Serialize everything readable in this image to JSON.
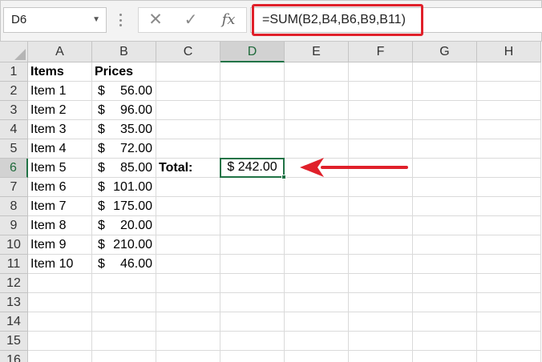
{
  "name_box": {
    "value": "D6"
  },
  "formula_bar": {
    "cancel_icon": "✕",
    "enter_icon": "✓",
    "function_icon": "fx",
    "formula": "=SUM(B2,B4,B6,B9,B11)"
  },
  "columns": [
    "A",
    "B",
    "C",
    "D",
    "E",
    "F",
    "G",
    "H"
  ],
  "rows": [
    "1",
    "2",
    "3",
    "4",
    "5",
    "6",
    "7",
    "8",
    "9",
    "10",
    "11",
    "12",
    "13",
    "14",
    "15",
    "16"
  ],
  "cells": {
    "A1": "Items",
    "B1": "Prices",
    "A2": "Item 1",
    "B2_sym": "$",
    "B2_val": "56.00",
    "A3": "Item 2",
    "B3_sym": "$",
    "B3_val": "96.00",
    "A4": "Item 3",
    "B4_sym": "$",
    "B4_val": "35.00",
    "A5": "Item 4",
    "B5_sym": "$",
    "B5_val": "72.00",
    "A6": "Item 5",
    "B6_sym": "$",
    "B6_val": "85.00",
    "A7": "Item 6",
    "B7_sym": "$",
    "B7_val": "101.00",
    "A8": "Item 7",
    "B8_sym": "$",
    "B8_val": "175.00",
    "A9": "Item 8",
    "B9_sym": "$",
    "B9_val": "20.00",
    "A10": "Item 9",
    "B10_sym": "$",
    "B10_val": "210.00",
    "A11": "Item 10",
    "B11_sym": "$",
    "B11_val": "46.00",
    "C6": "Total:",
    "D6": "$ 242.00"
  },
  "active_cell": {
    "column": "D",
    "row": "6"
  },
  "colors": {
    "highlight": "#e0202a",
    "selection": "#217346",
    "header_bg": "#e6e6e6"
  }
}
